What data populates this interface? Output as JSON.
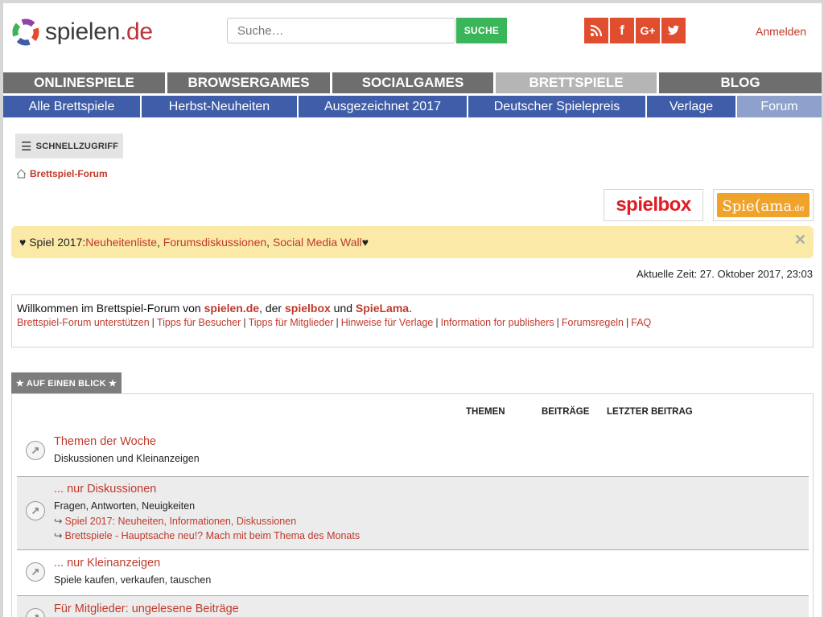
{
  "header": {
    "logo_name": "spielen",
    "logo_tld": ".de",
    "search_placeholder": "Suche…",
    "search_button": "SUCHE",
    "social": [
      "rss-icon",
      "facebook-icon",
      "google-plus-icon",
      "twitter-icon"
    ],
    "login": "Anmelden"
  },
  "mainnav": [
    {
      "label": "ONLINESPIELE",
      "active": false
    },
    {
      "label": "BROWSERGAMES",
      "active": false
    },
    {
      "label": "SOCIALGAMES",
      "active": false
    },
    {
      "label": "BRETTSPIELE",
      "active": true
    },
    {
      "label": "BLOG",
      "active": false
    }
  ],
  "subnav": [
    {
      "label": "Alle Brettspiele",
      "active": false
    },
    {
      "label": "Herbst-Neuheiten",
      "active": false
    },
    {
      "label": "Ausgezeichnet 2017",
      "active": false
    },
    {
      "label": "Deutscher Spielepreis",
      "active": false
    },
    {
      "label": "Verlage",
      "active": false
    },
    {
      "label": "Forum",
      "active": true
    }
  ],
  "quickaccess": "SCHNELLZUGRIFF",
  "breadcrumb": "Brettspiel-Forum",
  "partners": {
    "spielbox": "spielbox",
    "spielama_a": "Spie",
    "spielama_b": "ama",
    "spielama_c": ".de"
  },
  "notice": {
    "prefix": "♥ Spiel 2017: ",
    "link1": "Neuheitenliste",
    "link2": "Forumsdiskussionen",
    "link3": "Social Media Wall",
    "suffix": " ♥",
    "close": "✕"
  },
  "time": "Aktuelle Zeit: 27. Oktober 2017, 23:03",
  "welcome": {
    "text1": "Willkommen im Brettspiel-Forum von ",
    "link1": "spielen.de",
    "text2": ", der ",
    "link2": "spielbox",
    "text3": " und ",
    "link3": "SpieLama",
    "text4": ".",
    "links": [
      "Brettspiel-Forum unterstützen",
      "Tipps für Besucher",
      "Tipps für Mitglieder",
      "Hinweise für Verlage",
      "Information for publishers",
      "Forumsregeln",
      "FAQ"
    ]
  },
  "section_tab": "★ AUF EINEN BLICK ★",
  "columns": {
    "topics": "THEMEN",
    "posts": "BEITRÄGE",
    "last": "LETZTER BEITRAG"
  },
  "forums": [
    {
      "title": "Themen der Woche",
      "desc": "Diskussionen und Kleinanzeigen",
      "sublinks": []
    },
    {
      "title": "... nur Diskussionen",
      "desc": "Fragen, Antworten, Neuigkeiten",
      "sublinks": [
        "Spiel 2017: Neuheiten, Informationen, Diskussionen",
        "Brettspiele - Hauptsache neu!? Mach mit beim Thema des Monats"
      ]
    },
    {
      "title": "... nur Kleinanzeigen",
      "desc": "Spiele kaufen, verkaufen, tauschen",
      "sublinks": []
    },
    {
      "title": "Für Mitglieder: ungelesene Beiträge",
      "desc": "",
      "sublinks": []
    }
  ],
  "colors": {
    "accent": "#c0392b",
    "nav_dark": "#6e6e6e",
    "subnav_blue": "#3f5da8",
    "notice_bg": "#fbe9a7",
    "search_green": "#3bb55a",
    "social_orange": "#e04e2f"
  }
}
